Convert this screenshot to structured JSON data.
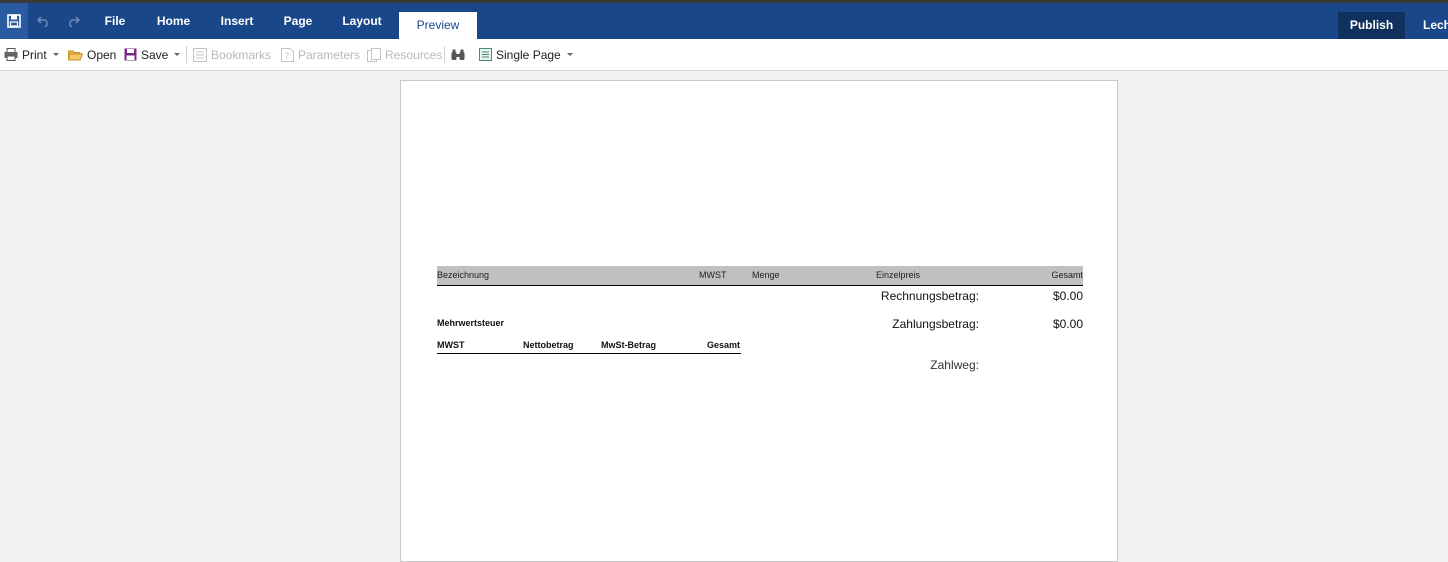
{
  "ribbon": {
    "tabs": [
      {
        "label": "File"
      },
      {
        "label": "Home"
      },
      {
        "label": "Insert"
      },
      {
        "label": "Page"
      },
      {
        "label": "Layout"
      },
      {
        "label": "Preview"
      }
    ],
    "publish_label": "Publish",
    "user_label": "Lech"
  },
  "toolbar": {
    "print": "Print",
    "open": "Open",
    "save": "Save",
    "bookmarks": "Bookmarks",
    "parameters": "Parameters",
    "resources": "Resources",
    "view_mode": "Single Page"
  },
  "report": {
    "columns": {
      "bezeichnung": "Bezeichnung",
      "mwst": "MWST",
      "menge": "Menge",
      "einzelpreis": "Einzelpreis",
      "gesamt": "Gesamt"
    },
    "rechnungsbetrag_label": "Rechnungsbetrag:",
    "rechnungsbetrag_value": "$0.00",
    "zahlungsbetrag_label": "Zahlungsbetrag:",
    "zahlungsbetrag_value": "$0.00",
    "zahlweg_label": "Zahlweg:",
    "vat_title": "Mehrwertsteuer",
    "vat_columns": {
      "mwst": "MWST",
      "netto": "Nettobetrag",
      "mwst_betrag": "MwSt-Betrag",
      "gesamt": "Gesamt"
    }
  },
  "colors": {
    "ribbon": "#19478a",
    "publish": "#10305e",
    "header_band": "#c0c0c0"
  }
}
